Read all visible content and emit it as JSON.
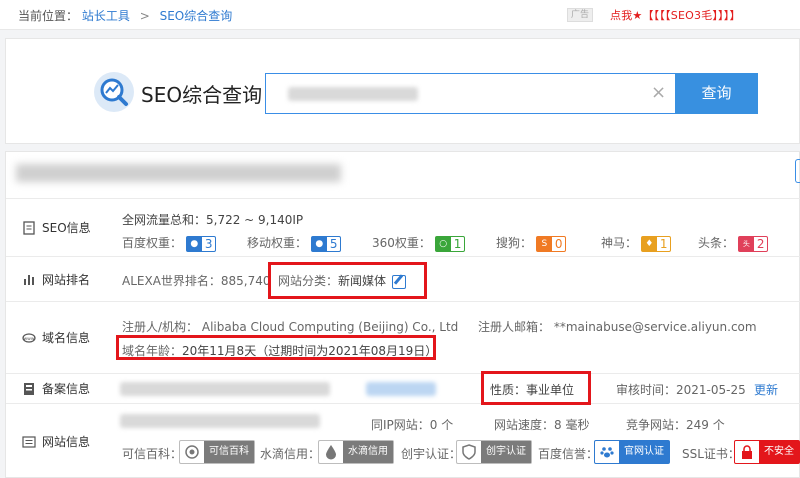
{
  "breadcrumb": {
    "prefix": "当前位置：",
    "home": "站长工具",
    "sep": ">",
    "current": "SEO综合查询"
  },
  "ad": {
    "tag": "广告",
    "text": "点我★【【【【SEO3毛】】】】"
  },
  "search": {
    "title": "SEO综合查询",
    "button": "查询",
    "clear": "×"
  },
  "seo": {
    "label": "SEO信息",
    "traffic": "全网流量总和：5,722 ~ 9,140IP",
    "items": [
      {
        "name": "百度权重：",
        "value": "3",
        "color": "#2e7ad0"
      },
      {
        "name": "移动权重：",
        "value": "5",
        "color": "#2e7ad0"
      },
      {
        "name": "360权重：",
        "value": "1",
        "color": "#3aa63a"
      },
      {
        "name": "搜狗：",
        "value": "0",
        "color": "#f07a24"
      },
      {
        "name": "神马：",
        "value": "1",
        "color": "#e8a020"
      },
      {
        "name": "头条：",
        "value": "2",
        "color": "#e0405a"
      }
    ]
  },
  "rank": {
    "label": "网站排名",
    "alexa": "ALEXA世界排名：885,740",
    "category_label": "网站分类：",
    "category": "新闻媒体"
  },
  "domain": {
    "label": "域名信息",
    "registrant": "注册人/机构：  Alibaba Cloud Computing (Beijing) Co., Ltd",
    "email": "注册人邮箱：  **mainabuse@service.aliyun.com",
    "age_label": "域名年龄：",
    "age": "20年11月8天（过期时间为2021年08月19日）"
  },
  "icp": {
    "label": "备案信息",
    "nature": "性质：事业单位",
    "audit": "审核时间：2021-05-25",
    "update": "更新"
  },
  "site": {
    "label": "网站信息",
    "same_ip": "同IP网站：0 个",
    "speed": "网站速度：8 毫秒",
    "competitors": "竞争网站：249 个",
    "certs": [
      {
        "label": "可信百科：",
        "badge": "可信百科",
        "color": "#7b7b7b"
      },
      {
        "label": "水滴信用：",
        "badge": "水滴信用",
        "color": "#7b7b7b"
      },
      {
        "label": "创宇认证：",
        "badge": "创宇认证",
        "color": "#7b7b7b"
      },
      {
        "label": "百度信誉：",
        "badge": "官网认证",
        "color": "#2e7ad0"
      },
      {
        "label": "SSL证书：",
        "badge": "不安全",
        "color": "#e3161b"
      }
    ]
  }
}
